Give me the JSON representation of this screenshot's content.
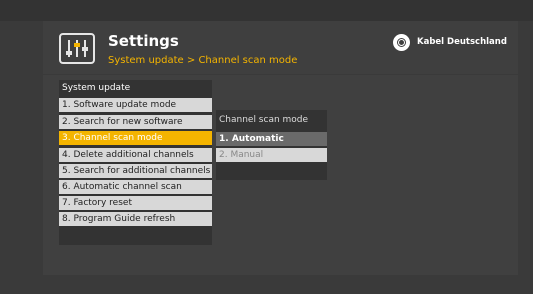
{
  "header": {
    "title": "Settings",
    "breadcrumb": "System update > Channel scan mode",
    "brand": "Kabel Deutschland",
    "icon": "equalizer-sliders-icon",
    "brand_icon": "kabel-deutschland-logo-icon"
  },
  "menu": {
    "title": "System update",
    "items": [
      {
        "label": "1. Software update mode"
      },
      {
        "label": "2. Search for new software"
      },
      {
        "label": "3. Channel scan mode"
      },
      {
        "label": "4. Delete additional channels"
      },
      {
        "label": "5. Search for additional channels"
      },
      {
        "label": "6. Automatic channel scan"
      },
      {
        "label": "7. Factory reset"
      },
      {
        "label": "8. Program Guide refresh"
      }
    ],
    "selected_index": 2
  },
  "submenu": {
    "title": "Channel scan mode",
    "options": [
      {
        "label": "1. Automatic"
      },
      {
        "label": "2. Manual"
      }
    ],
    "selected_index": 0
  },
  "colors": {
    "accent": "#f4b400",
    "background": "#3a3a3a",
    "item_background": "#d8d8d8"
  }
}
